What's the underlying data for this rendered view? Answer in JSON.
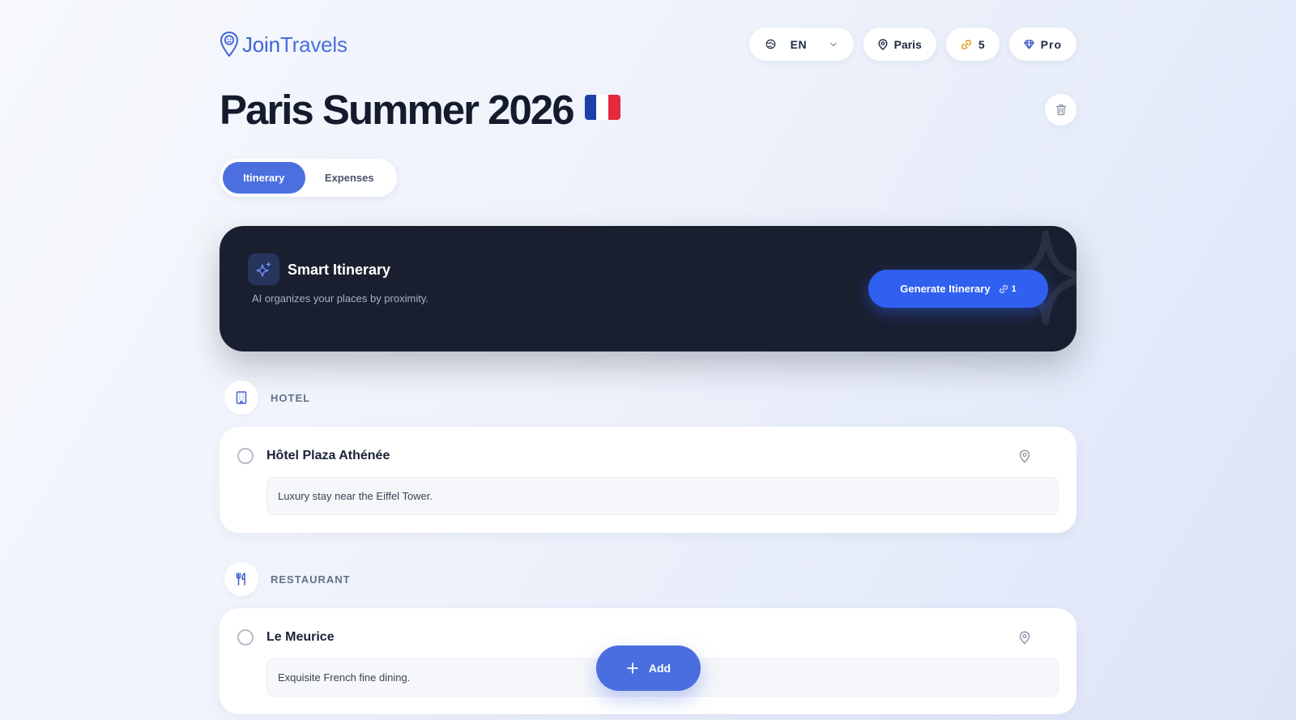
{
  "app": {
    "logo_text_a": "Join",
    "logo_text_b": "Travels",
    "brand_color": "#3f63d8"
  },
  "header": {
    "language": "EN",
    "city": "Paris",
    "credits": "5",
    "plan": "Pro"
  },
  "trip": {
    "title": "Paris Summer 2026",
    "flag_colors": [
      "#1f3fa8",
      "#ffffff",
      "#e5283c"
    ]
  },
  "tabs": [
    {
      "label": "Itinerary",
      "active": true
    },
    {
      "label": "Expenses",
      "active": false
    }
  ],
  "smart_itinerary": {
    "title": "Smart Itinerary",
    "subtitle": "AI organizes your places by proximity.",
    "button_label": "Generate Itinerary",
    "button_cost": "1"
  },
  "sections": [
    {
      "label": "HOTEL",
      "icon": "building-icon",
      "places": [
        {
          "name": "Hôtel Plaza Athénée",
          "note": "Luxury stay near the Eiffel Tower."
        }
      ]
    },
    {
      "label": "RESTAURANT",
      "icon": "utensils-icon",
      "places": [
        {
          "name": "Le Meurice",
          "note": "Exquisite French fine dining."
        }
      ]
    }
  ],
  "fab": {
    "label": "Add"
  }
}
